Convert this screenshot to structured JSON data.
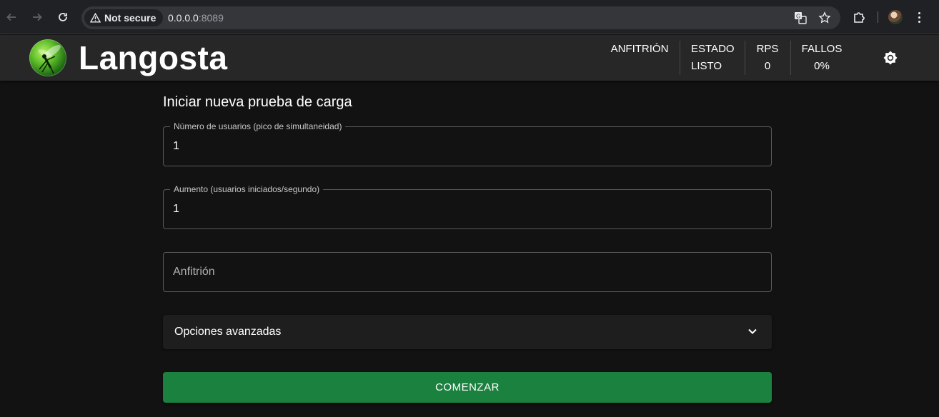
{
  "browser": {
    "security_label": "Not secure",
    "url_host": "0.0.0.0",
    "url_port": ":8089"
  },
  "header": {
    "brand": "Langosta",
    "stats": [
      {
        "label": "ANFITRIÓN",
        "value": ""
      },
      {
        "label": "ESTADO",
        "value": "LISTO"
      },
      {
        "label": "RPS",
        "value": "0"
      },
      {
        "label": "FALLOS",
        "value": "0%"
      }
    ]
  },
  "form": {
    "title": "Iniciar nueva prueba de carga",
    "users": {
      "label": "Número de usuarios (pico de simultaneidad)",
      "value": "1"
    },
    "spawn_rate": {
      "label": "Aumento (usuarios iniciados/segundo)",
      "value": "1"
    },
    "host": {
      "placeholder": "Anfitrión"
    },
    "advanced_label": "Opciones avanzadas",
    "start_label": "COMENZAR"
  },
  "colors": {
    "accent": "#1b813f",
    "background": "#121212",
    "header": "#272727"
  }
}
